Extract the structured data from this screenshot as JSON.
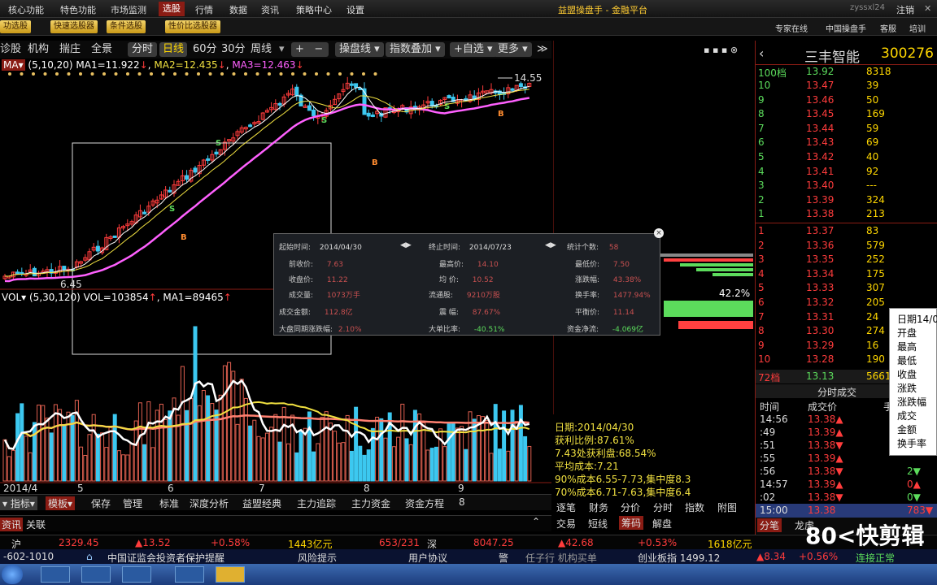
{
  "menu": {
    "items": [
      "核心功能",
      "特色功能",
      "市场监测",
      "选股",
      "行情",
      "数据",
      "资讯",
      "策略中心",
      "设置"
    ],
    "title": "益盟操盘手 - 金融平台",
    "user": "zyssxl24",
    "logout": "注销"
  },
  "toolbar2": {
    "buttons": [
      "功选股",
      "快速选股器",
      "条件选股",
      "性价比选股器"
    ],
    "right": [
      "专家在线",
      "中国操盘手",
      "客服",
      "培训"
    ]
  },
  "chart_toolbar": {
    "left": [
      "诊股",
      "机构",
      "揣庄",
      "全景"
    ],
    "periods": [
      "分时",
      "日线",
      "60分",
      "30分",
      "周线"
    ],
    "plus": "+",
    "minus": "−",
    "buttons": [
      "操盘线",
      "指数叠加",
      "自选",
      "更多"
    ]
  },
  "ma": {
    "name": "MA",
    "params": "(5,10,20)",
    "ma1": "MA1=11.922",
    "ma2": "MA2=12.435",
    "ma3": "MA3=12.463",
    "high": "14.55",
    "low": "6.45"
  },
  "vol": {
    "name": "VOL",
    "params": "(5,30,120)",
    "vol": "VOL=103854",
    "ma1": "MA1=89465"
  },
  "xaxis": [
    "2014/4",
    "5",
    "6",
    "7",
    "8",
    "9"
  ],
  "chip_pct": "42.2%",
  "popup": {
    "rows": [
      [
        [
          "起始时间:",
          "2014/04/30"
        ],
        [
          "终止时间:",
          "2014/07/23"
        ],
        [
          "统计个数:",
          "58"
        ]
      ],
      [
        [
          "前收价:",
          "7.63"
        ],
        [
          "最高价:",
          "14.10"
        ],
        [
          "最低价:",
          "7.50"
        ]
      ],
      [
        [
          "收盘价:",
          "11.22"
        ],
        [
          "均 价:",
          "10.52"
        ],
        [
          "涨跌幅:",
          "43.38%"
        ]
      ],
      [
        [
          "成交量:",
          "1073万手"
        ],
        [
          "流通股:",
          "9210万股"
        ],
        [
          "换手率:",
          "1477.94%"
        ]
      ],
      [
        [
          "成交金额:",
          "112.8亿"
        ],
        [
          "震 幅:",
          "87.67%"
        ],
        [
          "平衡价:",
          "11.14"
        ]
      ],
      [
        [
          "大盘同期涨跌幅:",
          "2.10%"
        ],
        [
          "大单比率:",
          "-40.51%"
        ],
        [
          "资金净流:",
          "-4.069亿"
        ]
      ]
    ]
  },
  "chip_info": [
    "日期:2014/04/30",
    "获利比例:87.61%",
    "7.43处获利盘:68.54%",
    "平均成本:7.21",
    "90%成本6.55-7.73,集中度8.3",
    "70%成本6.71-7.63,集中度6.4"
  ],
  "mid_tabs1": [
    "逐笔",
    "财务",
    "分价",
    "分时",
    "指数",
    "附图"
  ],
  "mid_tabs2": [
    "交易",
    "短线",
    "筹码",
    "解盘"
  ],
  "left_tabs": [
    "指标",
    "模板",
    "保存",
    "管理",
    "标准",
    "深度分析",
    "益盟经典",
    "主力追踪",
    "主力资金",
    "资金方程",
    "8"
  ],
  "news_tabs": [
    "资讯",
    "关联"
  ],
  "stock": {
    "name": "三丰智能",
    "code": "300276"
  },
  "orderbook": {
    "top": {
      "label": "100档",
      "price": "13.92",
      "vol": "8318"
    },
    "sells": [
      [
        "10",
        "13.47",
        "39"
      ],
      [
        "9",
        "13.46",
        "50"
      ],
      [
        "8",
        "13.45",
        "169"
      ],
      [
        "7",
        "13.44",
        "59"
      ],
      [
        "6",
        "13.43",
        "69"
      ],
      [
        "5",
        "13.42",
        "40"
      ],
      [
        "4",
        "13.41",
        "92"
      ],
      [
        "3",
        "13.40",
        "---"
      ],
      [
        "2",
        "13.39",
        "324"
      ],
      [
        "1",
        "13.38",
        "213"
      ]
    ],
    "buys": [
      [
        "1",
        "13.37",
        "83"
      ],
      [
        "2",
        "13.36",
        "579"
      ],
      [
        "3",
        "13.35",
        "252"
      ],
      [
        "4",
        "13.34",
        "175"
      ],
      [
        "5",
        "13.33",
        "307"
      ],
      [
        "6",
        "13.32",
        "205"
      ],
      [
        "7",
        "13.31",
        "24"
      ],
      [
        "8",
        "13.30",
        "274"
      ],
      [
        "9",
        "13.29",
        "16"
      ],
      [
        "10",
        "13.28",
        "190"
      ]
    ],
    "bottom": {
      "label": "72档",
      "price": "13.13",
      "vol": "5661"
    }
  },
  "trades": {
    "title": "分时成交",
    "headers": [
      "时间",
      "成交价",
      "手"
    ],
    "rows": [
      [
        "14:56",
        "13.38▲",
        ""
      ],
      [
        ":49",
        "13.39▲",
        ""
      ],
      [
        ":51",
        "13.38▼",
        ""
      ],
      [
        ":55",
        "13.39▲",
        ""
      ],
      [
        ":56",
        "13.38▼",
        "2▼"
      ],
      [
        "14:57",
        "13.39▲",
        "0▲"
      ],
      [
        ":02",
        "13.38▼",
        "0▼"
      ],
      [
        "15:00",
        "13.38",
        "783▼"
      ]
    ]
  },
  "right_tabs": [
    "分笔",
    "龙虎"
  ],
  "context_menu": [
    "日期14/0",
    "开盘",
    "最高",
    "最低",
    "收盘",
    "涨跌",
    "涨跌幅",
    "成交",
    "金额",
    "换手率"
  ],
  "status1": {
    "sh_label": "沪",
    "sh_val": "2329.45",
    "sh_chg": "▲13.52",
    "sh_pct": "+0.58%",
    "sh_amt": "1443亿元",
    "sh_ud": "653/231",
    "sz_label": "深",
    "sz_val": "8047.25",
    "sz_chg": "▲42.68",
    "sz_pct": "+0.53%",
    "sz_amt": "1618亿元"
  },
  "status2": {
    "phone": "-602-1010",
    "items": [
      "中国证监会投资者保护提醒",
      "风险提示",
      "用户协议",
      "警",
      "任子行 机构买单",
      "创业板指 1499.12",
      "▲8.34",
      "+0.56%",
      "连接正常"
    ]
  },
  "watermark": "80<快剪辑",
  "colors": {
    "up": "#ff3c3c",
    "down": "#3cc8f0",
    "ma1": "#ffffff",
    "ma2": "#f0e040",
    "ma3": "#ff60ff",
    "accent": "#8a1c14"
  }
}
